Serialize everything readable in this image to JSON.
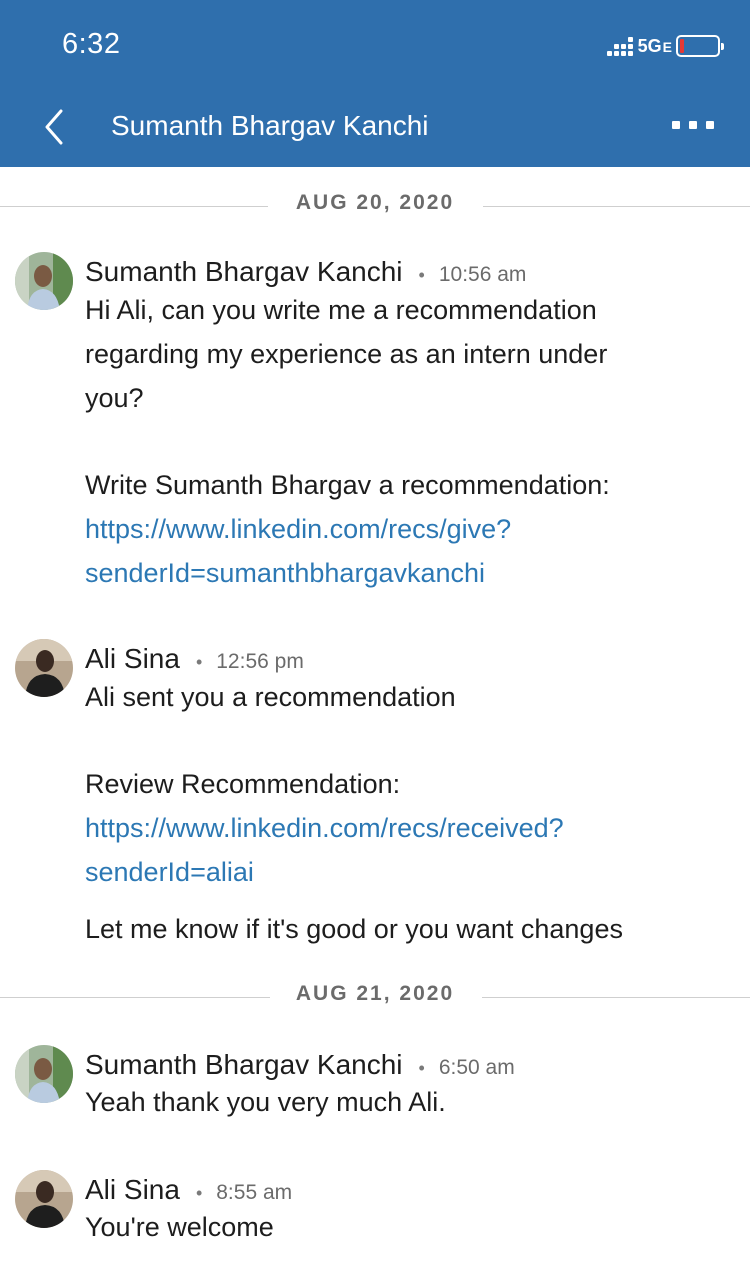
{
  "status_bar": {
    "time": "6:32",
    "network": "5G",
    "network_suffix": "E"
  },
  "header": {
    "title": "Sumanth Bhargav Kanchi"
  },
  "dates": [
    "AUG 20, 2020",
    "AUG 21, 2020"
  ],
  "messages": [
    {
      "sender": "Sumanth Bhargav Kanchi",
      "time": "10:56 am",
      "lines": [
        "Hi Ali, can you write me a recommendation",
        "regarding my experience as an intern under",
        "you?",
        "Write Sumanth Bhargav a recommendation:",
        "https://www.linkedin.com/recs/give?",
        "senderId=sumanthbhargavkanchi"
      ]
    },
    {
      "sender": "Ali Sina",
      "time": "12:56 pm",
      "lines": [
        "Ali sent you a recommendation",
        "Review Recommendation:",
        "https://www.linkedin.com/recs/received?",
        "senderId=aliai",
        "Let me know if it's good or you want changes"
      ]
    },
    {
      "sender": "Sumanth Bhargav Kanchi",
      "time": "6:50 am",
      "lines": [
        "Yeah thank you very much Ali."
      ]
    },
    {
      "sender": "Ali Sina",
      "time": "8:55 am",
      "lines": [
        "You're welcome"
      ]
    }
  ],
  "colors": {
    "header_bg": "#2f6fad",
    "link": "#2c78b4",
    "text": "#1d1d1d",
    "muted": "#6b6b6b"
  },
  "icons": {
    "back": "chevron-left-icon",
    "more": "more-horizontal-icon",
    "signal": "signal-icon",
    "battery": "battery-icon"
  }
}
